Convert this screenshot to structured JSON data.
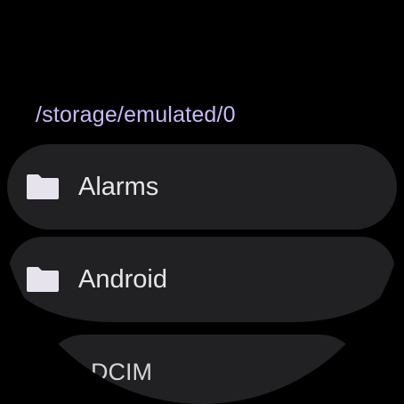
{
  "header": {
    "path": "/storage/emulated/0"
  },
  "folders": [
    {
      "label": "Alarms",
      "icon": "folder-icon"
    },
    {
      "label": "Android",
      "icon": "folder-icon"
    },
    {
      "label": "DCIM",
      "icon": "folder-icon"
    }
  ],
  "colors": {
    "background": "#000000",
    "accent_path": "#c9b8f5",
    "item_background": "#212124",
    "item_text": "#e6e6e9",
    "icon_fill": "#e6e3ec"
  }
}
